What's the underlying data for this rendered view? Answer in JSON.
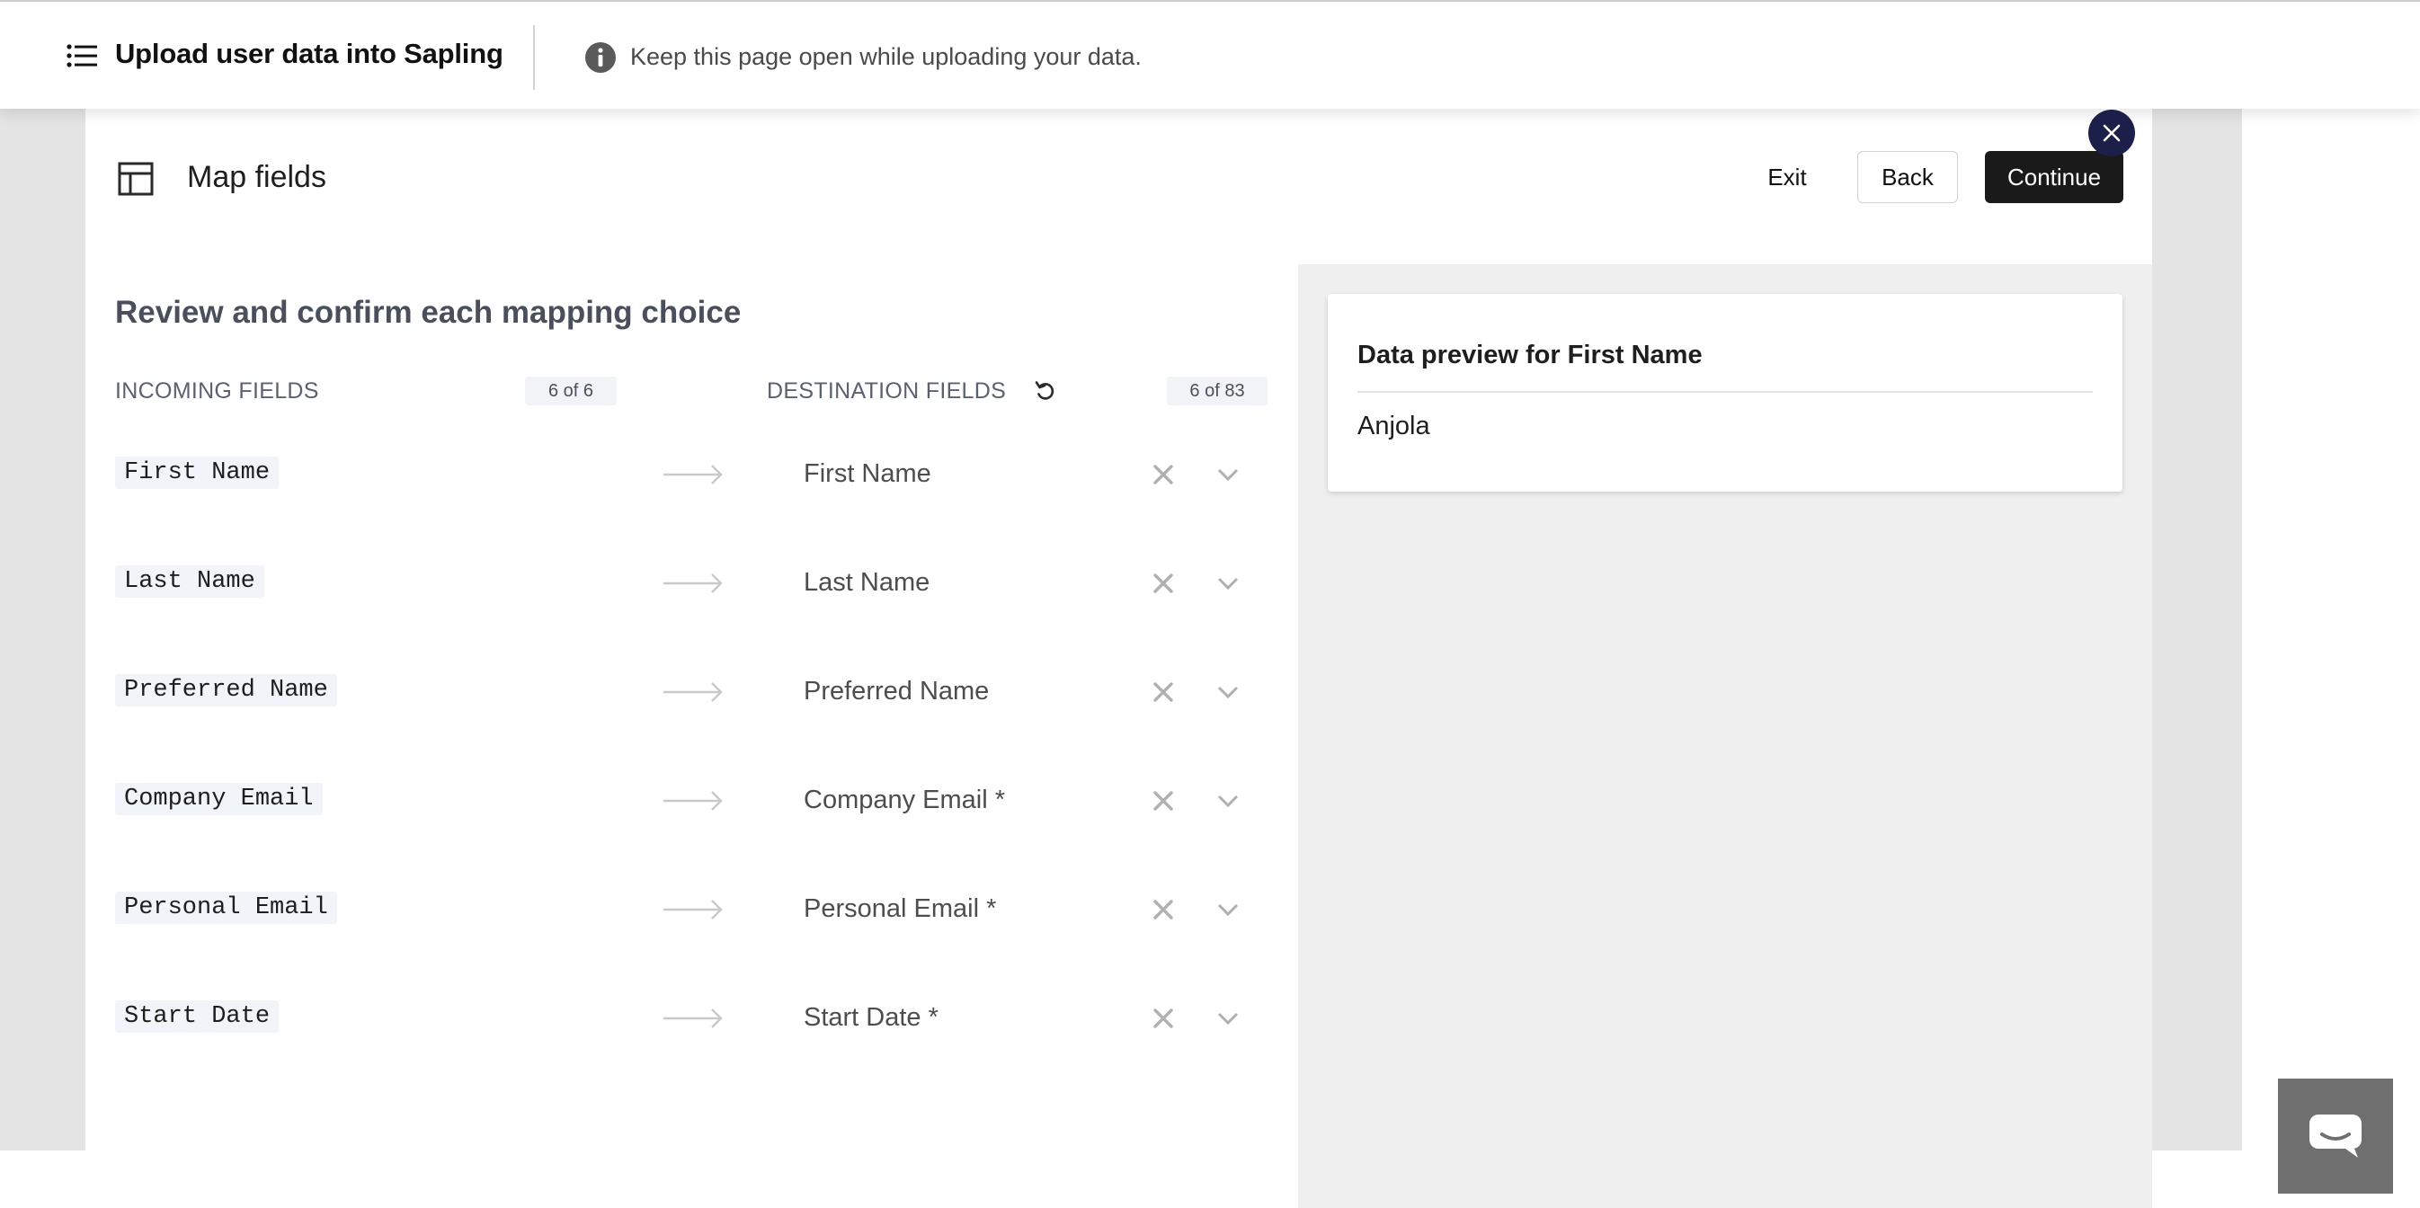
{
  "header": {
    "title": "Upload user data into Sapling",
    "notice": "Keep this page open while uploading your data."
  },
  "step": {
    "title": "Map fields",
    "exit_label": "Exit",
    "back_label": "Back",
    "continue_label": "Continue"
  },
  "mapping": {
    "heading": "Review and confirm each mapping choice",
    "incoming_label": "INCOMING FIELDS",
    "incoming_count": "6 of 6",
    "destination_label": "DESTINATION FIELDS",
    "destination_count": "6 of 83",
    "rows": [
      {
        "incoming": "First Name",
        "destination": "First Name"
      },
      {
        "incoming": "Last Name",
        "destination": "Last Name"
      },
      {
        "incoming": "Preferred Name",
        "destination": "Preferred Name"
      },
      {
        "incoming": "Company Email",
        "destination": "Company Email *"
      },
      {
        "incoming": "Personal Email",
        "destination": "Personal Email *"
      },
      {
        "incoming": "Start Date",
        "destination": "Start Date *"
      }
    ]
  },
  "preview": {
    "title": "Data preview for First Name",
    "value": "Anjola"
  },
  "icons": {
    "menu": "list-icon",
    "info": "info-icon",
    "step": "table-icon",
    "close": "close-icon",
    "reset": "reset-icon",
    "arrow": "arrow-right-icon",
    "clear": "x-icon",
    "dropdown": "chevron-down-icon",
    "chat": "chat-bubble-icon"
  },
  "colors": {
    "primary_button": "#1a1a1a",
    "close_fab": "#1b1f4a",
    "chat_widget": "#6f6f6f"
  }
}
